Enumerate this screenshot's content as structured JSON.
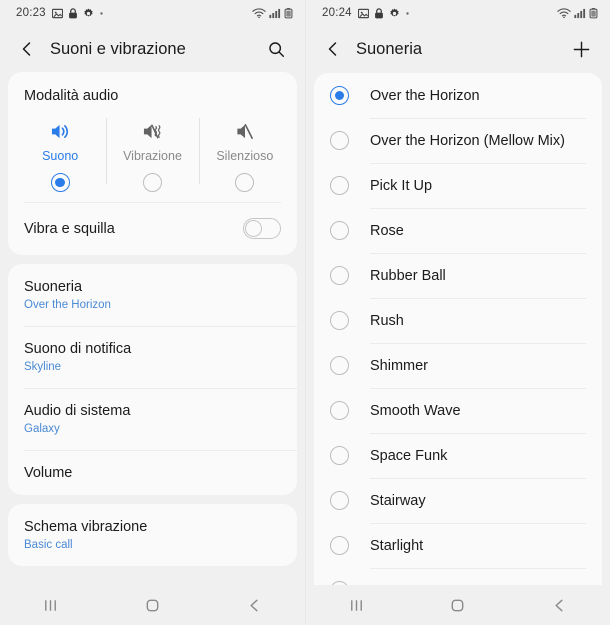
{
  "accent_color": "#2a7ce8",
  "subtitle_color": "#4a8ad4",
  "card_color": "#fafafa",
  "background_color": "#f0f0f0",
  "left": {
    "statusbar": {
      "time": "20:23",
      "icons": [
        "image-icon",
        "lock-icon",
        "gear-icon",
        "dot-icon"
      ],
      "right_icons": [
        "wifi-icon",
        "signal-icon",
        "battery-icon"
      ]
    },
    "appbar": {
      "back_icon": "chevron-left-icon",
      "title": "Suoni e vibrazione",
      "action_icon": "search-icon"
    },
    "audio_mode": {
      "section_title": "Modalità audio",
      "modes": [
        {
          "label": "Suono",
          "icon": "speaker-on-icon",
          "selected": true
        },
        {
          "label": "Vibrazione",
          "icon": "vibrate-icon",
          "selected": false
        },
        {
          "label": "Silenzioso",
          "icon": "speaker-mute-icon",
          "selected": false
        }
      ],
      "toggle_row": {
        "label": "Vibra e squilla",
        "enabled": false
      }
    },
    "settings_rows": [
      {
        "title": "Suoneria",
        "subtitle": "Over the Horizon"
      },
      {
        "title": "Suono di notifica",
        "subtitle": "Skyline"
      },
      {
        "title": "Audio di sistema",
        "subtitle": "Galaxy"
      },
      {
        "title": "Volume",
        "subtitle": ""
      }
    ],
    "settings_rows_second": [
      {
        "title": "Schema vibrazione",
        "subtitle": "Basic call"
      }
    ],
    "navbar": [
      "recents-icon",
      "home-icon",
      "back-icon"
    ]
  },
  "right": {
    "statusbar": {
      "time": "20:24",
      "icons": [
        "image-icon",
        "lock-icon",
        "gear-icon",
        "dot-icon"
      ],
      "right_icons": [
        "wifi-icon",
        "signal-icon",
        "battery-icon"
      ]
    },
    "appbar": {
      "back_icon": "chevron-left-icon",
      "title": "Suoneria",
      "action_icon": "plus-icon"
    },
    "ringtones": [
      {
        "label": "Over the Horizon",
        "selected": true
      },
      {
        "label": "Over the Horizon (Mellow Mix)",
        "selected": false
      },
      {
        "label": "Pick It Up",
        "selected": false
      },
      {
        "label": "Rose",
        "selected": false
      },
      {
        "label": "Rubber Ball",
        "selected": false
      },
      {
        "label": "Rush",
        "selected": false
      },
      {
        "label": "Shimmer",
        "selected": false
      },
      {
        "label": "Smooth Wave",
        "selected": false
      },
      {
        "label": "Space Funk",
        "selected": false
      },
      {
        "label": "Stairway",
        "selected": false
      },
      {
        "label": "Starlight",
        "selected": false
      }
    ],
    "navbar": [
      "recents-icon",
      "home-icon",
      "back-icon"
    ]
  }
}
